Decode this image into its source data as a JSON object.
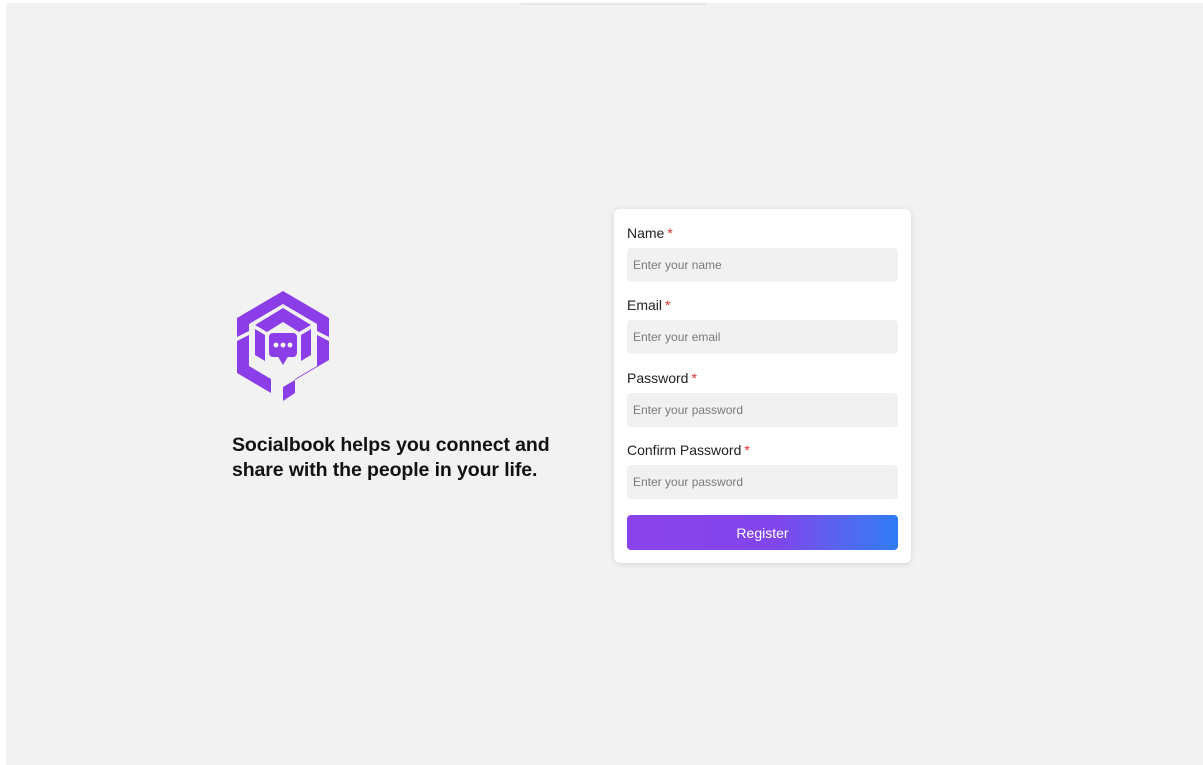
{
  "brand": {
    "logo_icon": "hexagon-chat-logo-icon",
    "tagline": "Socialbook helps you connect and share with the people in your life.",
    "accent_color": "#8b3ee8"
  },
  "form": {
    "required_marker": "*",
    "name": {
      "label": "Name",
      "placeholder": "Enter your name"
    },
    "email": {
      "label": "Email",
      "placeholder": "Enter your email"
    },
    "password": {
      "label": "Password",
      "placeholder": "Enter your password"
    },
    "confirm_password": {
      "label": "Confirm Password",
      "placeholder": "Enter your password"
    },
    "register_label": "Register",
    "button_gradient": [
      "#8a43ea",
      "#2f7cf5"
    ],
    "required_color": "#e0302e"
  }
}
